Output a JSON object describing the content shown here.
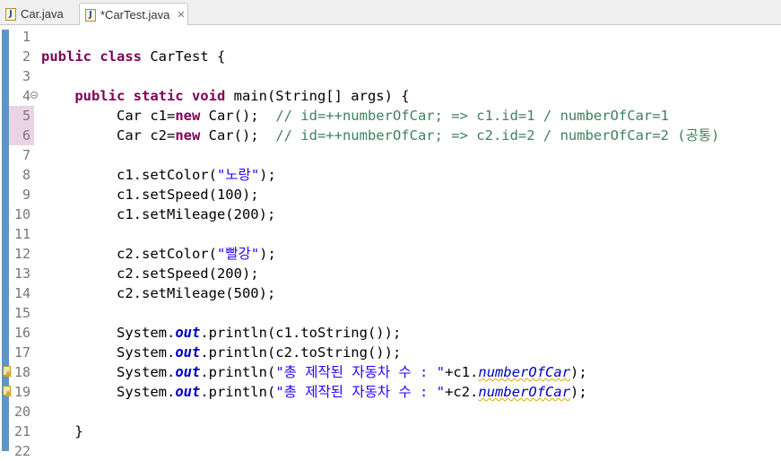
{
  "tabs": [
    {
      "label": "Car.java",
      "active": false
    },
    {
      "label": "*CarTest.java",
      "active": true
    }
  ],
  "tab_close_glyph": "✕",
  "colors": {
    "keyword": "#7f0055",
    "comment": "#3f7f5f",
    "string": "#2a00ff",
    "field": "#0000c0",
    "change_bar": "#5e95c6"
  },
  "lines": [
    {
      "n": "1",
      "segs": []
    },
    {
      "n": "2",
      "segs": [
        {
          "t": "kw",
          "v": "public class "
        },
        {
          "t": "p",
          "v": "CarTest {"
        }
      ]
    },
    {
      "n": "3",
      "segs": []
    },
    {
      "n": "4",
      "fold": true,
      "segs": [
        {
          "t": "p",
          "v": "    "
        },
        {
          "t": "kw",
          "v": "public static void "
        },
        {
          "t": "p",
          "v": "main(String[] args) {"
        }
      ]
    },
    {
      "n": "5",
      "modified": true,
      "segs": [
        {
          "t": "p",
          "v": "         Car c1="
        },
        {
          "t": "kw",
          "v": "new"
        },
        {
          "t": "p",
          "v": " Car();  "
        },
        {
          "t": "cm",
          "v": "// id=++numberOfCar; => c1.id=1 / numberOfCar=1"
        }
      ]
    },
    {
      "n": "6",
      "modified": true,
      "segs": [
        {
          "t": "p",
          "v": "         Car c2="
        },
        {
          "t": "kw",
          "v": "new"
        },
        {
          "t": "p",
          "v": " Car();  "
        },
        {
          "t": "cm",
          "v": "// id=++numberOfCar; => c2.id=2 / numberOfCar=2 (공통)"
        }
      ]
    },
    {
      "n": "7",
      "segs": []
    },
    {
      "n": "8",
      "segs": [
        {
          "t": "p",
          "v": "         c1.setColor("
        },
        {
          "t": "st",
          "v": "\"노랑\""
        },
        {
          "t": "p",
          "v": ");"
        }
      ]
    },
    {
      "n": "9",
      "segs": [
        {
          "t": "p",
          "v": "         c1.setSpeed(100);"
        }
      ]
    },
    {
      "n": "10",
      "segs": [
        {
          "t": "p",
          "v": "         c1.setMileage(200);"
        }
      ]
    },
    {
      "n": "11",
      "segs": []
    },
    {
      "n": "12",
      "segs": [
        {
          "t": "p",
          "v": "         c2.setColor("
        },
        {
          "t": "st",
          "v": "\"빨강\""
        },
        {
          "t": "p",
          "v": ");"
        }
      ]
    },
    {
      "n": "13",
      "segs": [
        {
          "t": "p",
          "v": "         c2.setSpeed(200);"
        }
      ]
    },
    {
      "n": "14",
      "segs": [
        {
          "t": "p",
          "v": "         c2.setMileage(500);"
        }
      ]
    },
    {
      "n": "15",
      "segs": []
    },
    {
      "n": "16",
      "segs": [
        {
          "t": "p",
          "v": "         System."
        },
        {
          "t": "fld",
          "v": "out"
        },
        {
          "t": "p",
          "v": ".println(c1.toString());"
        }
      ]
    },
    {
      "n": "17",
      "segs": [
        {
          "t": "p",
          "v": "         System."
        },
        {
          "t": "fld",
          "v": "out"
        },
        {
          "t": "p",
          "v": ".println(c2.toString());"
        }
      ]
    },
    {
      "n": "18",
      "warning": true,
      "segs": [
        {
          "t": "p",
          "v": "         System."
        },
        {
          "t": "fld",
          "v": "out"
        },
        {
          "t": "p",
          "v": ".println("
        },
        {
          "t": "st",
          "v": "\"총 제작된 자동차 수 : \""
        },
        {
          "t": "p",
          "v": "+c1."
        },
        {
          "t": "sfld",
          "v": "numberOfCar"
        },
        {
          "t": "p",
          "v": ");"
        }
      ]
    },
    {
      "n": "19",
      "warning": true,
      "segs": [
        {
          "t": "p",
          "v": "         System."
        },
        {
          "t": "fld",
          "v": "out"
        },
        {
          "t": "p",
          "v": ".println("
        },
        {
          "t": "st",
          "v": "\"총 제작된 자동차 수 : \""
        },
        {
          "t": "p",
          "v": "+c2."
        },
        {
          "t": "sfld",
          "v": "numberOfCar"
        },
        {
          "t": "p",
          "v": ");"
        }
      ]
    },
    {
      "n": "20",
      "segs": []
    },
    {
      "n": "21",
      "segs": [
        {
          "t": "p",
          "v": "    }"
        }
      ]
    },
    {
      "n": "22",
      "segs": []
    }
  ]
}
